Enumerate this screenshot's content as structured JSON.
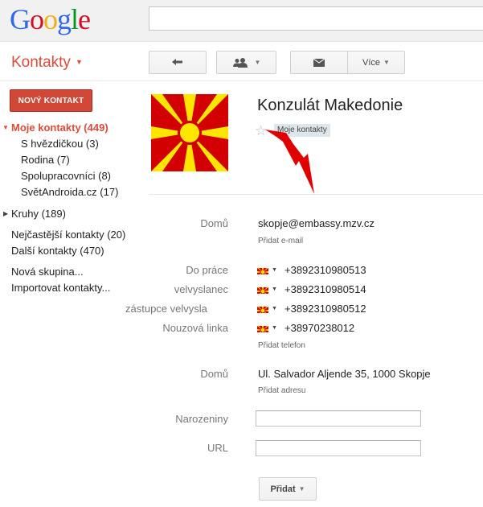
{
  "logo": {
    "letters": [
      "G",
      "o",
      "o",
      "g",
      "l",
      "e"
    ],
    "colors": [
      "#3369e8",
      "#d50f25",
      "#eeb211",
      "#3369e8",
      "#009925",
      "#d50f25"
    ]
  },
  "app": {
    "title": "Kontakty"
  },
  "toolbar": {
    "back_icon": "back-arrow-icon",
    "groups_icon": "people-icon",
    "mail_icon": "mail-icon",
    "more_label": "Více"
  },
  "sidebar": {
    "new_contact_label": "NOVÝ KONTAKT",
    "my_contacts": "Moje kontakty (449)",
    "sub_items": [
      "S hvězdičkou (3)",
      "Rodina (7)",
      "Spolupracovníci (8)",
      "SvětAndroida.cz (17)"
    ],
    "circles": "Kruhy (189)",
    "frequent": "Nejčastější kontakty (20)",
    "other": "Další kontakty (470)",
    "new_group": "Nová skupina...",
    "import": "Importovat kontakty..."
  },
  "contact": {
    "name": "Konzulát Makedonie",
    "group_tag": "Moje kontakty",
    "email": {
      "label": "Domů",
      "value": "skopje@embassy.mzv.cz",
      "add": "Přidat e-mail"
    },
    "phones": [
      {
        "label": "Do práce",
        "value": "+3892310980513"
      },
      {
        "label": "velvyslanec",
        "value": "+3892310980514"
      },
      {
        "label": "zástupce velvysla",
        "value": "+3892310980512"
      },
      {
        "label": "Nouzová linka",
        "value": "+38970238012"
      }
    ],
    "add_phone": "Přidat telefon",
    "address": {
      "label": "Domů",
      "value": "Ul. Salvador Aljende 35, 1000 Skopje",
      "add": "Přidat adresu"
    },
    "birthday_label": "Narozeniny",
    "url_label": "URL",
    "add_button": "Přidat"
  },
  "colors": {
    "accent": "#dd4b39",
    "button_red": "#d14836",
    "flag_red": "#d20000",
    "flag_yellow": "#ffe600"
  }
}
